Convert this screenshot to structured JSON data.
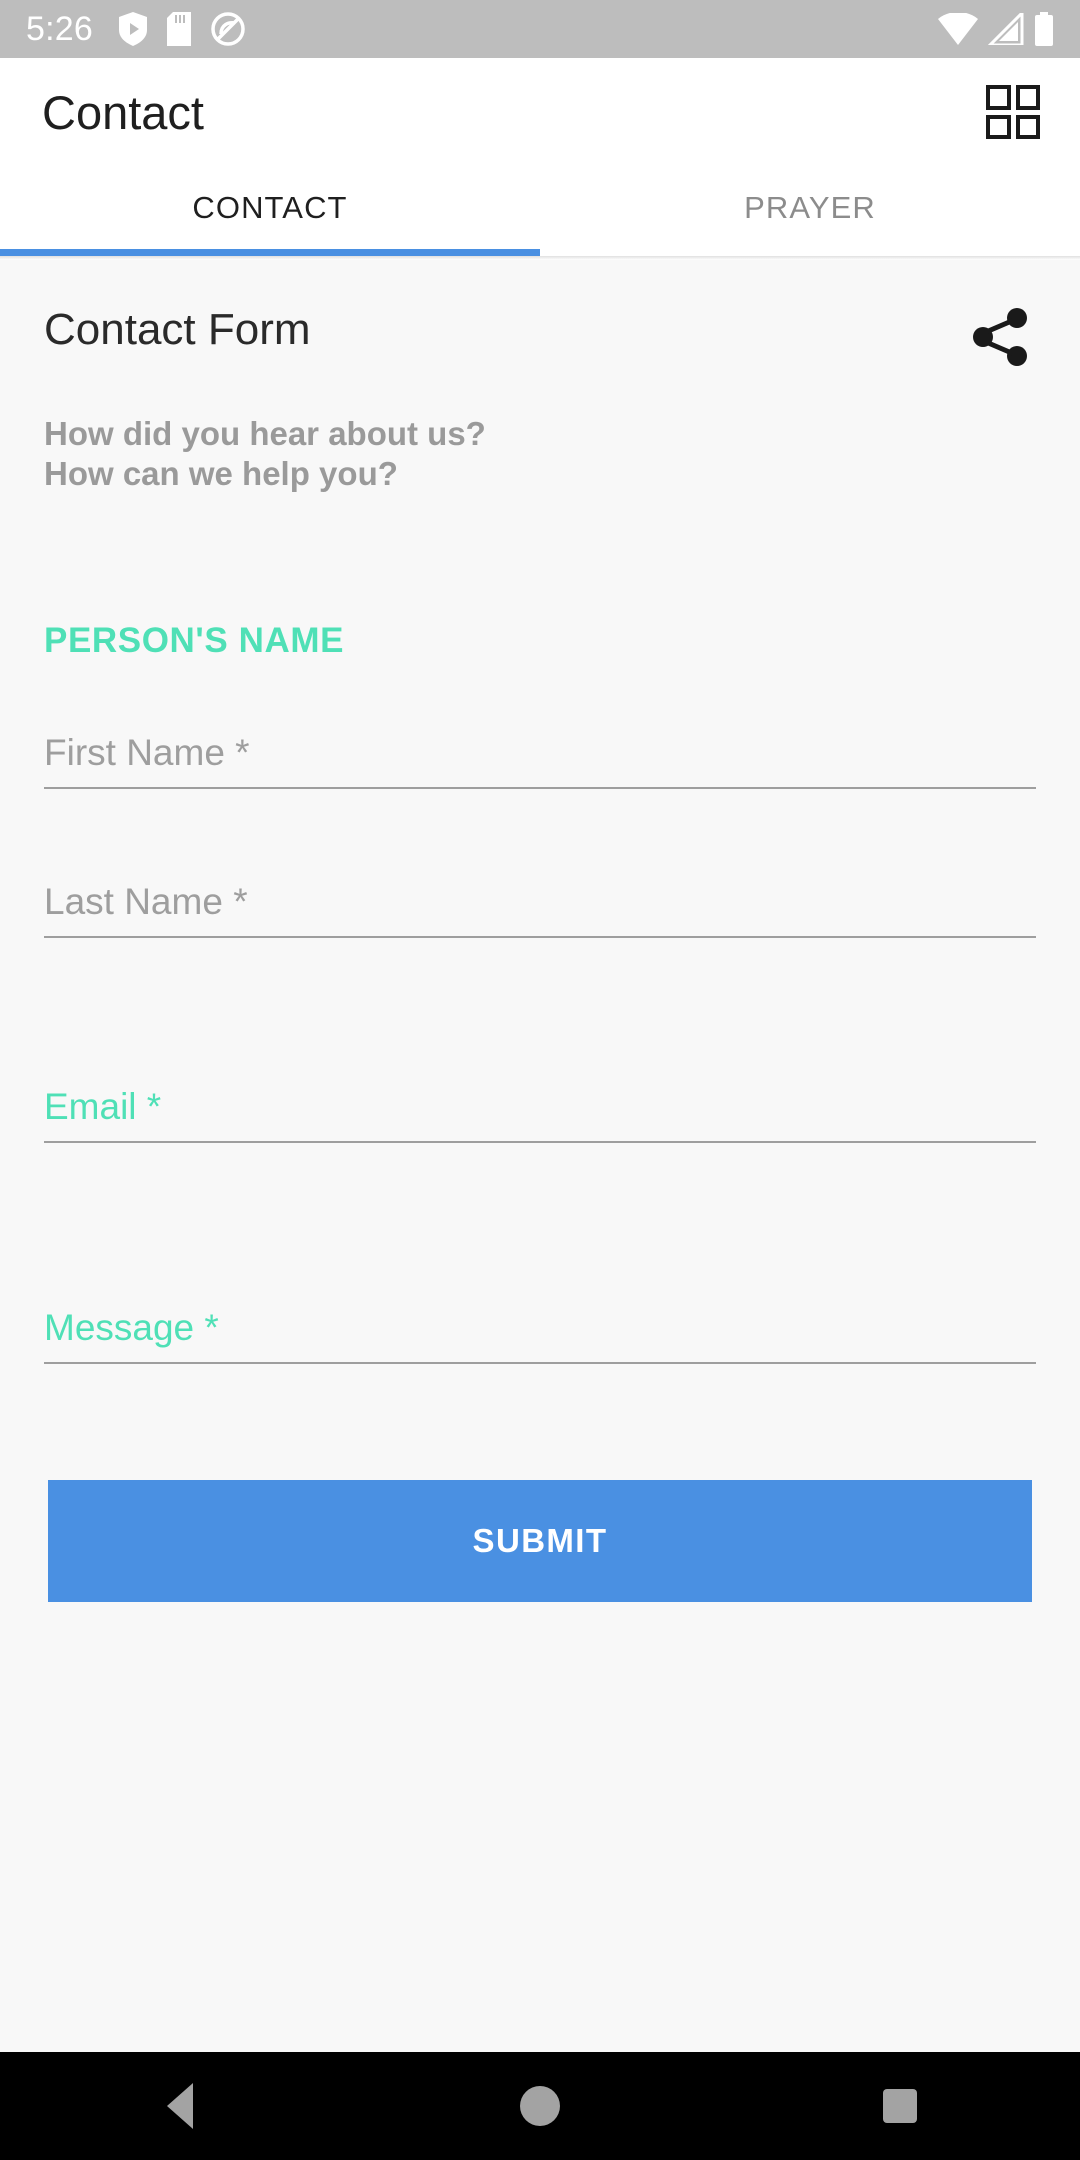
{
  "status_bar": {
    "time": "5:26",
    "left_icons": [
      "play-shield-icon",
      "sd-card-icon",
      "do-not-disturb-icon"
    ],
    "right_icons": [
      "wifi-icon",
      "cellular-signal-icon",
      "battery-icon"
    ],
    "background": "#bdbdbd"
  },
  "app_bar": {
    "title": "Contact",
    "action_icon": "grid-view-icon"
  },
  "tabs": {
    "items": [
      {
        "label": "CONTACT",
        "active": true
      },
      {
        "label": "PRAYER",
        "active": false
      }
    ],
    "indicator_color": "#4a90e2"
  },
  "form": {
    "title": "Contact Form",
    "share_icon": "share-icon",
    "description_lines": [
      "How did you hear about us?",
      "How can we help you?"
    ],
    "section_label": "PERSON'S NAME",
    "section_label_color": "#4fe0b6",
    "fields": [
      {
        "name": "first-name",
        "placeholder": "First Name *",
        "value": "",
        "accent": false
      },
      {
        "name": "last-name",
        "placeholder": "Last Name *",
        "value": "",
        "accent": false
      },
      {
        "name": "email",
        "placeholder": "Email *",
        "value": "",
        "accent": true
      },
      {
        "name": "message",
        "placeholder": "Message *",
        "value": "",
        "accent": true
      }
    ],
    "submit_label": "SUBMIT",
    "submit_color": "#4a90e2"
  },
  "nav_bar": {
    "back": "back-triangle-icon",
    "home": "home-circle-icon",
    "recents": "recents-square-icon"
  }
}
